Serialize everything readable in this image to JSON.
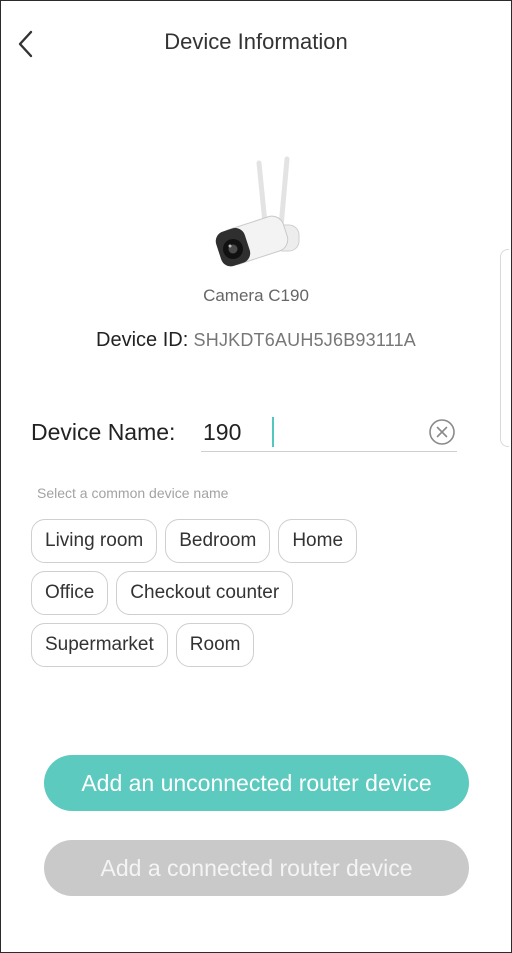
{
  "header": {
    "title": "Device Information",
    "back_icon": "chevron-left-icon"
  },
  "device": {
    "image_icon": "security-camera-icon",
    "model": "Camera C190",
    "id_label": "Device ID:",
    "id_value": "SHJKDT6AUH5J6B93111A"
  },
  "name_field": {
    "label": "Device Name:",
    "value": "190",
    "clear_icon": "clear-circle-icon"
  },
  "suggestions": {
    "hint": "Select a common device name",
    "rows": [
      [
        "Living room",
        "Bedroom",
        "Home"
      ],
      [
        "Office",
        "Checkout counter"
      ],
      [
        "Supermarket",
        "Room"
      ]
    ]
  },
  "actions": {
    "primary_label": "Add an unconnected router device",
    "secondary_label": "Add a connected router device"
  },
  "colors": {
    "accent": "#5ccabf",
    "disabled": "#c9c9c9"
  }
}
